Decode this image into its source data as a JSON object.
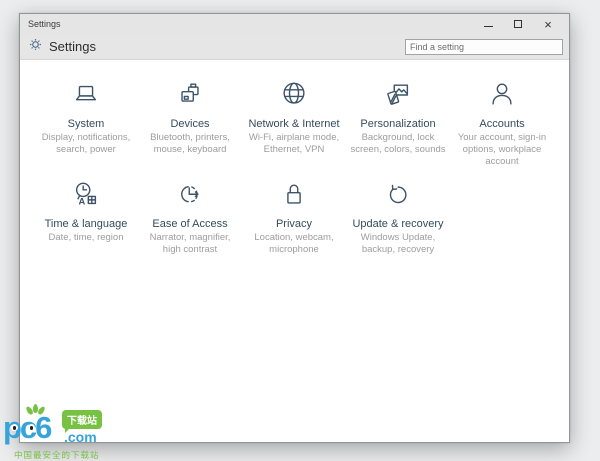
{
  "window": {
    "titlebar": {
      "title": "Settings",
      "minimize_glyph": "",
      "close_glyph": "×"
    },
    "header": {
      "title": "Settings",
      "search_placeholder": "Find a setting"
    },
    "tiles_row1": [
      {
        "icon": "laptop-icon",
        "title": "System",
        "subtitle": "Display, notifications, search, power"
      },
      {
        "icon": "printer-devices-icon",
        "title": "Devices",
        "subtitle": "Bluetooth, printers, mouse, keyboard"
      },
      {
        "icon": "globe-icon",
        "title": "Network & Internet",
        "subtitle": "Wi-Fi, airplane mode, Ethernet, VPN"
      },
      {
        "icon": "photos-icon",
        "title": "Personalization",
        "subtitle": "Background, lock screen, colors, sounds"
      },
      {
        "icon": "person-icon",
        "title": "Accounts",
        "subtitle": "Your account, sign-in options, workplace account"
      }
    ],
    "tiles_row2": [
      {
        "icon": "clock-language-icon",
        "title": "Time & language",
        "subtitle": "Date, time, region"
      },
      {
        "icon": "dashed-clock-arrow-icon",
        "title": "Ease of Access",
        "subtitle": "Narrator, magnifier, high contrast"
      },
      {
        "icon": "padlock-icon",
        "title": "Privacy",
        "subtitle": "Location, webcam, microphone"
      },
      {
        "icon": "refresh-arrow-icon",
        "title": "Update & recovery",
        "subtitle": "Windows Update, backup, recovery"
      }
    ]
  },
  "watermark": {
    "name": "pc6",
    "badge": "下载站",
    "com": ".com",
    "tagline": "中国最安全的下载站",
    "blue": "#36a3da",
    "green": "#77c143"
  },
  "colors": {
    "titlebar_bg": "#e5e5e5",
    "header_bg": "#e6e6e6",
    "content_bg": "#ffffff",
    "icon_stroke": "#3d5368",
    "tile_title": "#344c5e",
    "tile_subtitle": "#9d9d9d"
  }
}
